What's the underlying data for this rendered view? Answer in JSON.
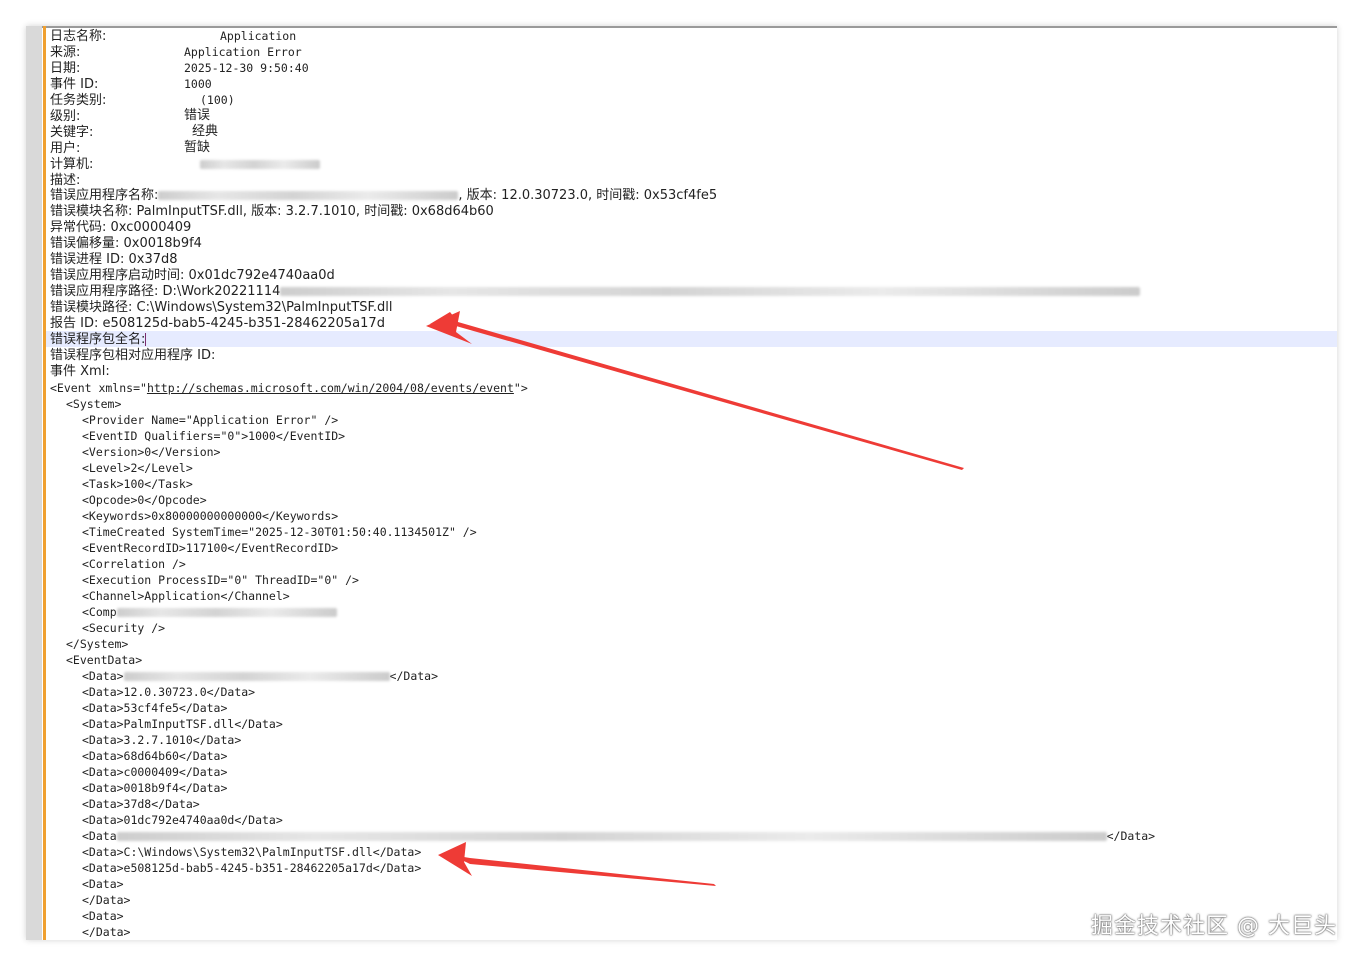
{
  "header_fields": [
    {
      "label": "日志名称:",
      "value": "Application"
    },
    {
      "label": "来源:",
      "value": "Application Error"
    },
    {
      "label": "日期:",
      "value": "2025-12-30 9:50:40"
    },
    {
      "label": "事件 ID:",
      "value": "1000"
    },
    {
      "label": "任务类别:",
      "value": "(100)"
    },
    {
      "label": "级别:",
      "value": "错误"
    },
    {
      "label": "关键字:",
      "value": "经典"
    },
    {
      "label": "用户:",
      "value": "暂缺"
    },
    {
      "label": "计算机:",
      "value": ""
    },
    {
      "label": "描述:",
      "value": ""
    }
  ],
  "description": {
    "app_name_label": "错误应用程序名称:",
    "app_name_tail": ", 版本: 12.0.30723.0, 时间戳: 0x53cf4fe5",
    "module_name": "错误模块名称: PalmInputTSF.dll, 版本: 3.2.7.1010, 时间戳: 0x68d64b60",
    "exception_code": "异常代码: 0xc0000409",
    "fault_offset": "错误偏移量: 0x0018b9f4",
    "process_id": "错误进程 ID: 0x37d8",
    "start_time": "错误应用程序启动时间: 0x01dc792e4740aa0d",
    "app_path_label": "错误应用程序路径: D:\\Work20221114",
    "module_path": "错误模块路径: C:\\Windows\\System32\\PalmInputTSF.dll",
    "report_id": "报告 ID: e508125d-bab5-4245-b351-28462205a17d",
    "package_full_name": "错误程序包全名:",
    "package_app_id": "错误程序包相对应用程序 ID:",
    "event_xml_label": "事件 Xml:"
  },
  "xml": {
    "event_open_prefix": "<Event xmlns=\"",
    "event_ns": "http://schemas.microsoft.com/win/2004/08/events/event",
    "event_open_suffix": "\">",
    "system_open": "<System>",
    "system_lines": [
      "<Provider Name=\"Application Error\" />",
      "<EventID Qualifiers=\"0\">1000</EventID>",
      "<Version>0</Version>",
      "<Level>2</Level>",
      "<Task>100</Task>",
      "<Opcode>0</Opcode>",
      "<Keywords>0x80000000000000</Keywords>",
      "<TimeCreated SystemTime=\"2025-12-30T01:50:40.1134501Z\" />",
      "<EventRecordID>117100</EventRecordID>",
      "<Correlation />",
      "<Execution ProcessID=\"0\" ThreadID=\"0\" />",
      "<Channel>Application</Channel>"
    ],
    "computer_prefix": "<Comp",
    "security_line": "<Security />",
    "system_close": "</System>",
    "eventdata_open": "<EventData>",
    "data_blurred_1_prefix": "<Data>",
    "data_blurred_1_suffix": "</Data>",
    "data_lines": [
      "<Data>12.0.30723.0</Data>",
      "<Data>53cf4fe5</Data>",
      "<Data>PalmInputTSF.dll</Data>",
      "<Data>3.2.7.1010</Data>",
      "<Data>68d64b60</Data>",
      "<Data>c0000409</Data>",
      "<Data>0018b9f4</Data>",
      "<Data>37d8</Data>",
      "<Data>01dc792e4740aa0d</Data>"
    ],
    "data_blurred_2_prefix": "<Data",
    "data_blurred_2_suffix": "</Data>",
    "data_tail_lines": [
      "<Data>C:\\Windows\\System32\\PalmInputTSF.dll</Data>",
      "<Data>e508125d-bab5-4245-b351-28462205a17d</Data>",
      "<Data>",
      "</Data>",
      "<Data>",
      "</Data>"
    ]
  },
  "watermark": "掘金技术社区 @ 大巨头",
  "colors": {
    "arrow": "#ee3b36",
    "margin": "#f0a030",
    "highlight": "#e6ebff"
  }
}
